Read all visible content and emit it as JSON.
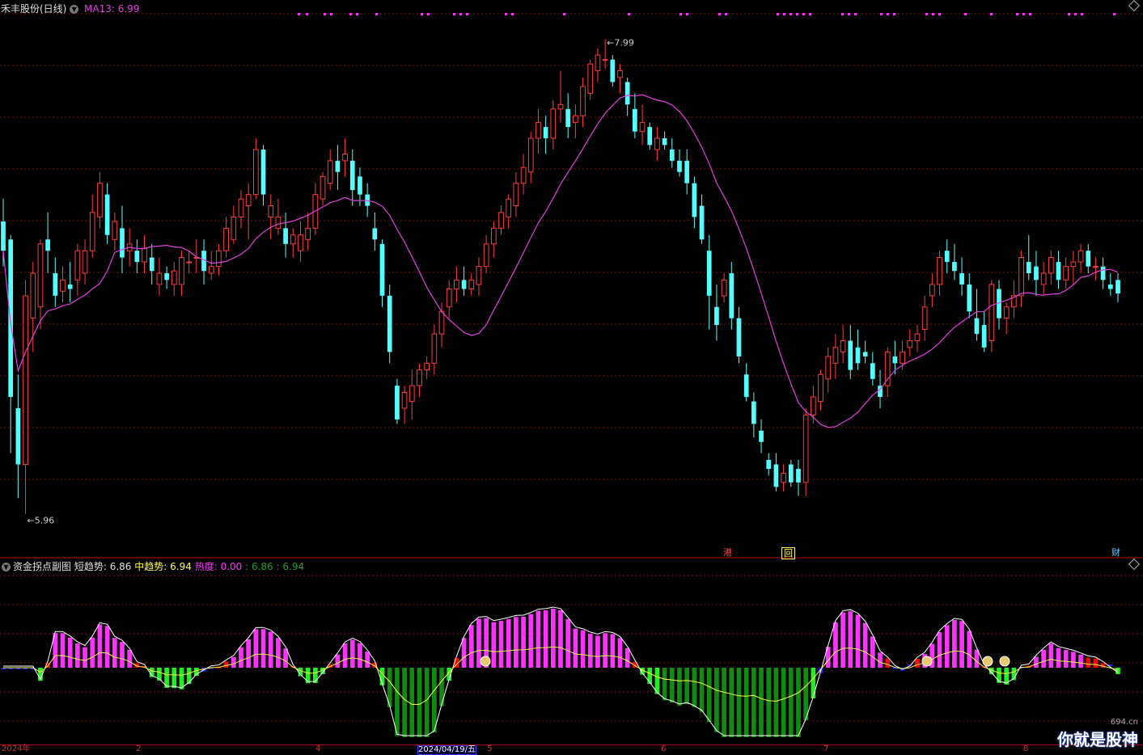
{
  "main_panel": {
    "stock_title": "禾丰股份(日线)",
    "indicator_name": "MA13",
    "indicator_value": "6.99",
    "high_label": "7.99",
    "low_label": "5.96",
    "markers": {
      "hk": "港",
      "review": "回",
      "finance": "财"
    }
  },
  "sub_panel": {
    "name": "资金拐点副图",
    "short_label": "短趋势:",
    "short_value": "6.86",
    "mid_label": "中趋势:",
    "mid_value": "6.94",
    "heat_label": "热度:",
    "heat_value": "0.00",
    "val4": "6.86",
    "val5": "6.94"
  },
  "date_axis": {
    "start": "2024年",
    "m2": "2",
    "m4": "4",
    "cursor": "2024/04/19/五",
    "m5": "5",
    "m6": "6",
    "m7": "7",
    "m8": "8"
  },
  "watermark": {
    "brand": "你就是股神",
    "site": "694.cn"
  },
  "colors": {
    "up": "#ff3b3b",
    "down": "#54ffff",
    "ma": "#e040e0",
    "grid": "#7a1010",
    "magenta": "#ff33ff",
    "label_yellow": "#ffff44"
  },
  "chart_data": {
    "type": "candlestick",
    "ylim": [
      5.8,
      8.1
    ],
    "ma_period": 13,
    "candles": [
      [
        7.18,
        7.28,
        6.98,
        7.05
      ],
      [
        7.1,
        7.12,
        6.15,
        6.4
      ],
      [
        6.35,
        6.5,
        5.95,
        6.1
      ],
      [
        6.1,
        6.92,
        5.88,
        6.85
      ],
      [
        6.75,
        7.0,
        6.6,
        6.95
      ],
      [
        6.8,
        7.1,
        6.7,
        7.08
      ],
      [
        7.1,
        7.22,
        6.95,
        7.05
      ],
      [
        6.95,
        7.02,
        6.8,
        6.85
      ],
      [
        6.87,
        6.98,
        6.82,
        6.92
      ],
      [
        6.9,
        7.0,
        6.82,
        6.88
      ],
      [
        6.92,
        7.08,
        6.85,
        7.05
      ],
      [
        6.95,
        7.1,
        6.9,
        7.05
      ],
      [
        7.05,
        7.3,
        7.02,
        7.22
      ],
      [
        7.2,
        7.4,
        7.15,
        7.35
      ],
      [
        7.3,
        7.35,
        7.08,
        7.12
      ],
      [
        7.1,
        7.22,
        7.05,
        7.18
      ],
      [
        7.15,
        7.25,
        6.95,
        7.02
      ],
      [
        7.05,
        7.15,
        6.98,
        7.08
      ],
      [
        7.05,
        7.1,
        6.95,
        7.0
      ],
      [
        7.0,
        7.12,
        6.95,
        7.06
      ],
      [
        7.02,
        7.08,
        6.9,
        6.96
      ],
      [
        6.9,
        7.02,
        6.85,
        6.95
      ],
      [
        6.95,
        6.98,
        6.88,
        6.92
      ],
      [
        6.9,
        7.0,
        6.85,
        6.96
      ],
      [
        6.9,
        7.05,
        6.85,
        7.02
      ],
      [
        7.0,
        7.05,
        6.95,
        7.0
      ],
      [
        7.02,
        7.1,
        6.95,
        7.02
      ],
      [
        7.05,
        7.1,
        6.9,
        6.96
      ],
      [
        6.95,
        7.05,
        6.92,
        6.98
      ],
      [
        6.98,
        7.08,
        6.94,
        7.05
      ],
      [
        7.05,
        7.2,
        7.02,
        7.15
      ],
      [
        7.1,
        7.25,
        7.08,
        7.2
      ],
      [
        7.2,
        7.32,
        7.15,
        7.28
      ],
      [
        7.25,
        7.35,
        7.1,
        7.3
      ],
      [
        7.3,
        7.55,
        7.28,
        7.5
      ],
      [
        7.5,
        7.52,
        7.25,
        7.3
      ],
      [
        7.2,
        7.3,
        7.1,
        7.25
      ],
      [
        7.15,
        7.28,
        7.12,
        7.2
      ],
      [
        7.15,
        7.22,
        7.02,
        7.08
      ],
      [
        7.08,
        7.15,
        7.02,
        7.12
      ],
      [
        7.05,
        7.18,
        7.0,
        7.12
      ],
      [
        7.1,
        7.22,
        7.05,
        7.15
      ],
      [
        7.15,
        7.35,
        7.12,
        7.3
      ],
      [
        7.28,
        7.4,
        7.25,
        7.38
      ],
      [
        7.35,
        7.5,
        7.32,
        7.45
      ],
      [
        7.45,
        7.52,
        7.32,
        7.4
      ],
      [
        7.45,
        7.55,
        7.38,
        7.48
      ],
      [
        7.45,
        7.5,
        7.25,
        7.32
      ],
      [
        7.38,
        7.42,
        7.25,
        7.3
      ],
      [
        7.3,
        7.35,
        7.2,
        7.25
      ],
      [
        7.15,
        7.22,
        7.05,
        7.1
      ],
      [
        7.08,
        7.1,
        6.8,
        6.85
      ],
      [
        6.85,
        6.9,
        6.55,
        6.6
      ],
      [
        6.45,
        6.48,
        6.28,
        6.3
      ],
      [
        6.35,
        6.45,
        6.28,
        6.42
      ],
      [
        6.38,
        6.52,
        6.3,
        6.45
      ],
      [
        6.45,
        6.55,
        6.4,
        6.52
      ],
      [
        6.52,
        6.58,
        6.48,
        6.55
      ],
      [
        6.55,
        6.72,
        6.5,
        6.68
      ],
      [
        6.68,
        6.82,
        6.62,
        6.78
      ],
      [
        6.8,
        6.92,
        6.75,
        6.88
      ],
      [
        6.88,
        6.98,
        6.82,
        6.92
      ],
      [
        6.92,
        6.98,
        6.85,
        6.88
      ],
      [
        6.88,
        6.95,
        6.85,
        6.92
      ],
      [
        6.9,
        7.02,
        6.85,
        6.98
      ],
      [
        6.98,
        7.12,
        6.95,
        7.08
      ],
      [
        7.08,
        7.18,
        7.02,
        7.15
      ],
      [
        7.15,
        7.25,
        7.12,
        7.22
      ],
      [
        7.2,
        7.3,
        7.15,
        7.28
      ],
      [
        7.25,
        7.4,
        7.2,
        7.35
      ],
      [
        7.35,
        7.48,
        7.3,
        7.42
      ],
      [
        7.4,
        7.58,
        7.35,
        7.55
      ],
      [
        7.55,
        7.68,
        7.48,
        7.62
      ],
      [
        7.6,
        7.65,
        7.48,
        7.55
      ],
      [
        7.55,
        7.72,
        7.5,
        7.68
      ],
      [
        7.68,
        7.85,
        7.62,
        7.7
      ],
      [
        7.68,
        7.75,
        7.55,
        7.6
      ],
      [
        7.62,
        7.7,
        7.55,
        7.65
      ],
      [
        7.65,
        7.82,
        7.6,
        7.78
      ],
      [
        7.75,
        7.9,
        7.72,
        7.88
      ],
      [
        7.85,
        7.95,
        7.8,
        7.92
      ],
      [
        7.9,
        7.99,
        7.86,
        7.9
      ],
      [
        7.9,
        7.92,
        7.78,
        7.8
      ],
      [
        7.82,
        7.88,
        7.75,
        7.85
      ],
      [
        7.8,
        7.82,
        7.65,
        7.7
      ],
      [
        7.68,
        7.75,
        7.55,
        7.58
      ],
      [
        7.58,
        7.7,
        7.52,
        7.62
      ],
      [
        7.6,
        7.62,
        7.5,
        7.52
      ],
      [
        7.5,
        7.6,
        7.45,
        7.55
      ],
      [
        7.55,
        7.58,
        7.5,
        7.52
      ],
      [
        7.5,
        7.55,
        7.42,
        7.45
      ],
      [
        7.45,
        7.5,
        7.38,
        7.4
      ],
      [
        7.45,
        7.5,
        7.3,
        7.35
      ],
      [
        7.35,
        7.38,
        7.15,
        7.2
      ],
      [
        7.25,
        7.3,
        7.08,
        7.1
      ],
      [
        7.05,
        7.12,
        6.7,
        6.85
      ],
      [
        6.8,
        6.9,
        6.65,
        6.72
      ],
      [
        6.85,
        6.95,
        6.82,
        6.92
      ],
      [
        6.95,
        7.0,
        6.7,
        6.75
      ],
      [
        6.75,
        6.8,
        6.55,
        6.58
      ],
      [
        6.5,
        6.55,
        6.38,
        6.4
      ],
      [
        6.38,
        6.42,
        6.22,
        6.28
      ],
      [
        6.25,
        6.3,
        6.15,
        6.2
      ],
      [
        6.12,
        6.15,
        6.05,
        6.08
      ],
      [
        6.1,
        6.15,
        5.98,
        6.0
      ],
      [
        6.02,
        6.1,
        5.98,
        6.06
      ],
      [
        6.1,
        6.12,
        6.0,
        6.02
      ],
      [
        6.08,
        6.12,
        5.96,
        6.02
      ],
      [
        6.02,
        6.35,
        5.96,
        6.32
      ],
      [
        6.32,
        6.45,
        6.28,
        6.4
      ],
      [
        6.38,
        6.52,
        6.34,
        6.5
      ],
      [
        6.48,
        6.62,
        6.42,
        6.58
      ],
      [
        6.55,
        6.68,
        6.48,
        6.62
      ],
      [
        6.6,
        6.72,
        6.55,
        6.65
      ],
      [
        6.65,
        6.72,
        6.48,
        6.52
      ],
      [
        6.62,
        6.7,
        6.52,
        6.55
      ],
      [
        6.6,
        6.65,
        6.55,
        6.58
      ],
      [
        6.55,
        6.6,
        6.45,
        6.48
      ],
      [
        6.45,
        6.52,
        6.35,
        6.4
      ],
      [
        6.45,
        6.62,
        6.4,
        6.6
      ],
      [
        6.58,
        6.65,
        6.5,
        6.55
      ],
      [
        6.55,
        6.65,
        6.52,
        6.6
      ],
      [
        6.62,
        6.7,
        6.58,
        6.65
      ],
      [
        6.65,
        6.72,
        6.6,
        6.68
      ],
      [
        6.7,
        6.85,
        6.65,
        6.8
      ],
      [
        6.85,
        6.95,
        6.8,
        6.9
      ],
      [
        6.9,
        7.05,
        6.85,
        7.02
      ],
      [
        7.05,
        7.1,
        6.95,
        7.0
      ],
      [
        7.0,
        7.08,
        6.92,
        6.96
      ],
      [
        6.95,
        7.02,
        6.85,
        6.9
      ],
      [
        6.9,
        6.95,
        6.75,
        6.78
      ],
      [
        6.75,
        6.88,
        6.65,
        6.68
      ],
      [
        6.72,
        6.78,
        6.6,
        6.62
      ],
      [
        6.65,
        6.92,
        6.6,
        6.9
      ],
      [
        6.88,
        6.92,
        6.7,
        6.75
      ],
      [
        6.75,
        6.82,
        6.68,
        6.8
      ],
      [
        6.8,
        6.92,
        6.75,
        6.85
      ],
      [
        6.85,
        7.05,
        6.8,
        7.02
      ],
      [
        7.0,
        7.12,
        6.92,
        6.95
      ],
      [
        6.98,
        7.05,
        6.85,
        6.92
      ],
      [
        6.9,
        7.0,
        6.85,
        6.95
      ],
      [
        6.95,
        7.05,
        6.9,
        7.02
      ],
      [
        7.0,
        7.05,
        6.88,
        6.92
      ],
      [
        6.92,
        7.02,
        6.88,
        6.98
      ],
      [
        6.98,
        7.05,
        6.9,
        7.0
      ],
      [
        7.0,
        7.08,
        6.95,
        7.05
      ],
      [
        7.05,
        7.08,
        6.95,
        6.98
      ],
      [
        6.98,
        7.02,
        6.92,
        6.98
      ],
      [
        6.98,
        7.02,
        6.88,
        6.92
      ],
      [
        6.9,
        6.95,
        6.85,
        6.88
      ],
      [
        6.92,
        6.95,
        6.82,
        6.86
      ]
    ]
  }
}
